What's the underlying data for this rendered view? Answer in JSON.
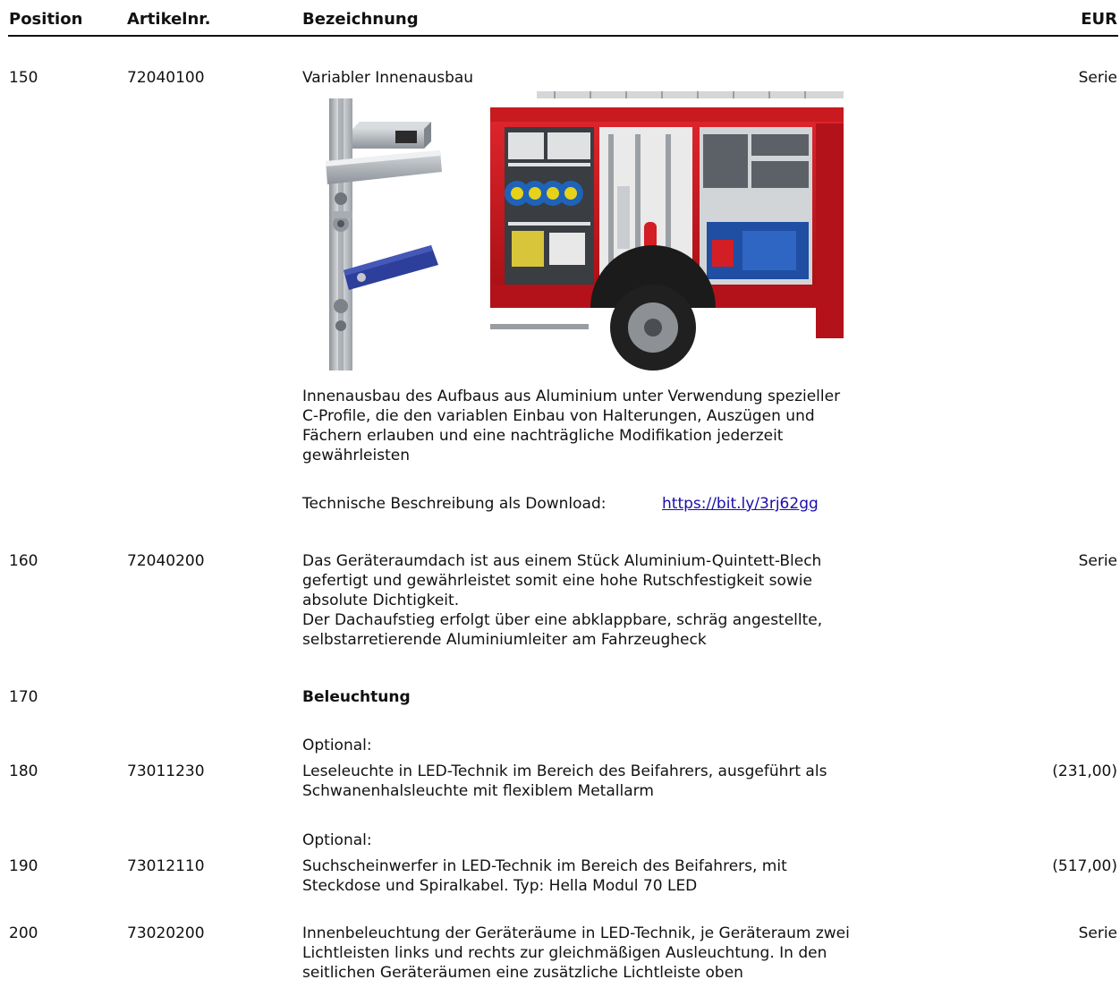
{
  "header": {
    "position": "Position",
    "article": "Artikelnr.",
    "description": "Bezeichnung",
    "currency": "EUR"
  },
  "rows": [
    {
      "position": "150",
      "article": "72040100",
      "title": "Variabler Innenausbau",
      "price": "Serie",
      "text": "Innenausbau des Aufbaus aus Aluminium unter Verwendung spezieller\nC-Profile, die den variablen Einbau von Halterungen, Auszügen und\nFächern erlauben und eine nachträgliche Modifikation jederzeit\ngewährleisten",
      "download_label": "Technische Beschreibung als Download:",
      "download_link": "https://bit.ly/3rj62gg"
    },
    {
      "position": "160",
      "article": "72040200",
      "price": "Serie",
      "text": "Das Geräteraumdach ist aus einem Stück Aluminium-Quintett-Blech\ngefertigt und gewährleistet somit eine hohe Rutschfestigkeit sowie\nabsolute Dichtigkeit.\nDer Dachaufstieg erfolgt über eine abklappbare, schräg angestellte,\nselbstarretierende Aluminiumleiter am Fahrzeugheck"
    },
    {
      "position": "170",
      "title": "Beleuchtung"
    },
    {
      "position": "180",
      "article": "73011230",
      "optional": "Optional:",
      "price": "(231,00)",
      "text": "Leseleuchte in LED-Technik im Bereich des Beifahrers, ausgeführt als\nSchwanenhalsleuchte mit flexiblem Metallarm"
    },
    {
      "position": "190",
      "article": "73012110",
      "optional": "Optional:",
      "price": "(517,00)",
      "text": "Suchscheinwerfer in LED-Technik im Bereich des Beifahrers, mit\nSteckdose und Spiralkabel. Typ: Hella Modul 70 LED"
    },
    {
      "position": "200",
      "article": "73020200",
      "price": "Serie",
      "text": "Innenbeleuchtung der Geräteräume in LED-Technik, je Geräteraum zwei\nLichtleisten links und rechts zur gleichmäßigen Ausleuchtung. In den\nseitlichen Geräteräumen eine zusätzliche Lichtleiste oben"
    }
  ],
  "colors": {
    "text": "#111111",
    "link": "#1a0dab",
    "truck_red": "#c8161d",
    "aluminium": "#b9bdc2",
    "strap_blue": "#2d3f9a"
  }
}
